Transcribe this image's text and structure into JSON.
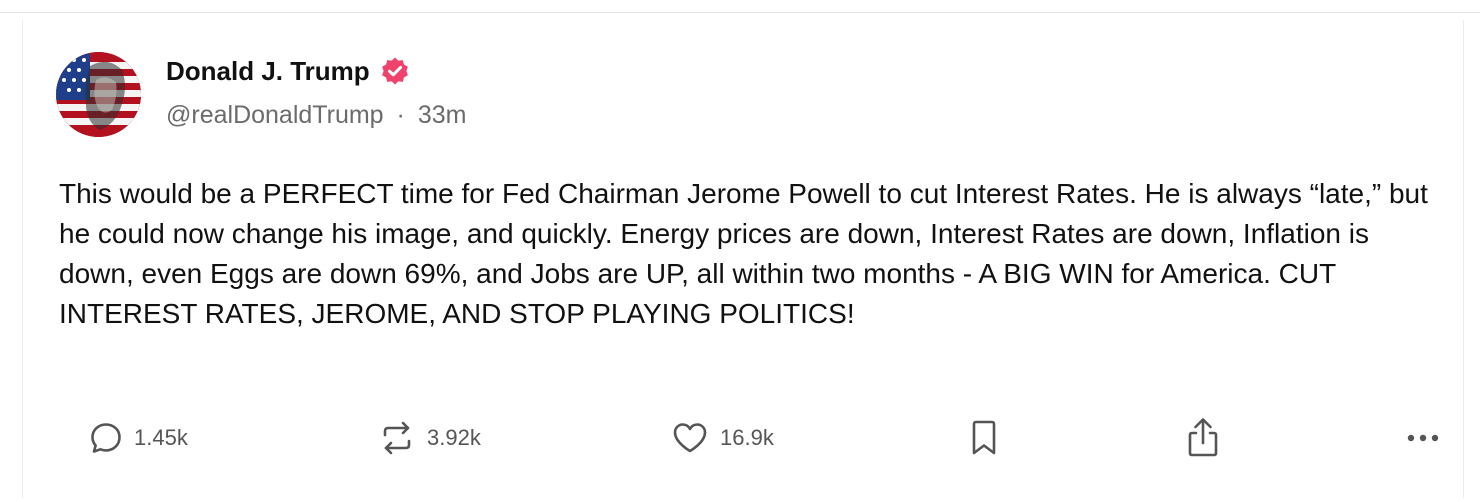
{
  "post": {
    "author_name": "Donald J. Trump",
    "handle": "@realDonaldTrump",
    "separator": "·",
    "time_ago": "33m",
    "text": "This would be a PERFECT time for Fed Chairman Jerome Powell to cut Interest Rates. He is always “late,” but he could now change his image, and quickly. Energy prices are down, Interest Rates are down, Inflation is down, even Eggs are down 69%, and Jobs are UP, all within two months - A BIG WIN for America. CUT INTEREST RATES, JEROME, AND STOP PLAYING POLITICS!"
  },
  "actions": {
    "reply_count": "1.45k",
    "repost_count": "3.92k",
    "like_count": "16.9k"
  },
  "icons": {
    "verified": "verified-badge-icon",
    "reply": "reply-icon",
    "repost": "repost-icon",
    "like": "heart-icon",
    "bookmark": "bookmark-icon",
    "share": "share-icon",
    "more": "more-icon"
  },
  "colors": {
    "verified": "#f0436b",
    "icon": "#555555",
    "text": "#111111",
    "muted": "#6b6b6b"
  }
}
